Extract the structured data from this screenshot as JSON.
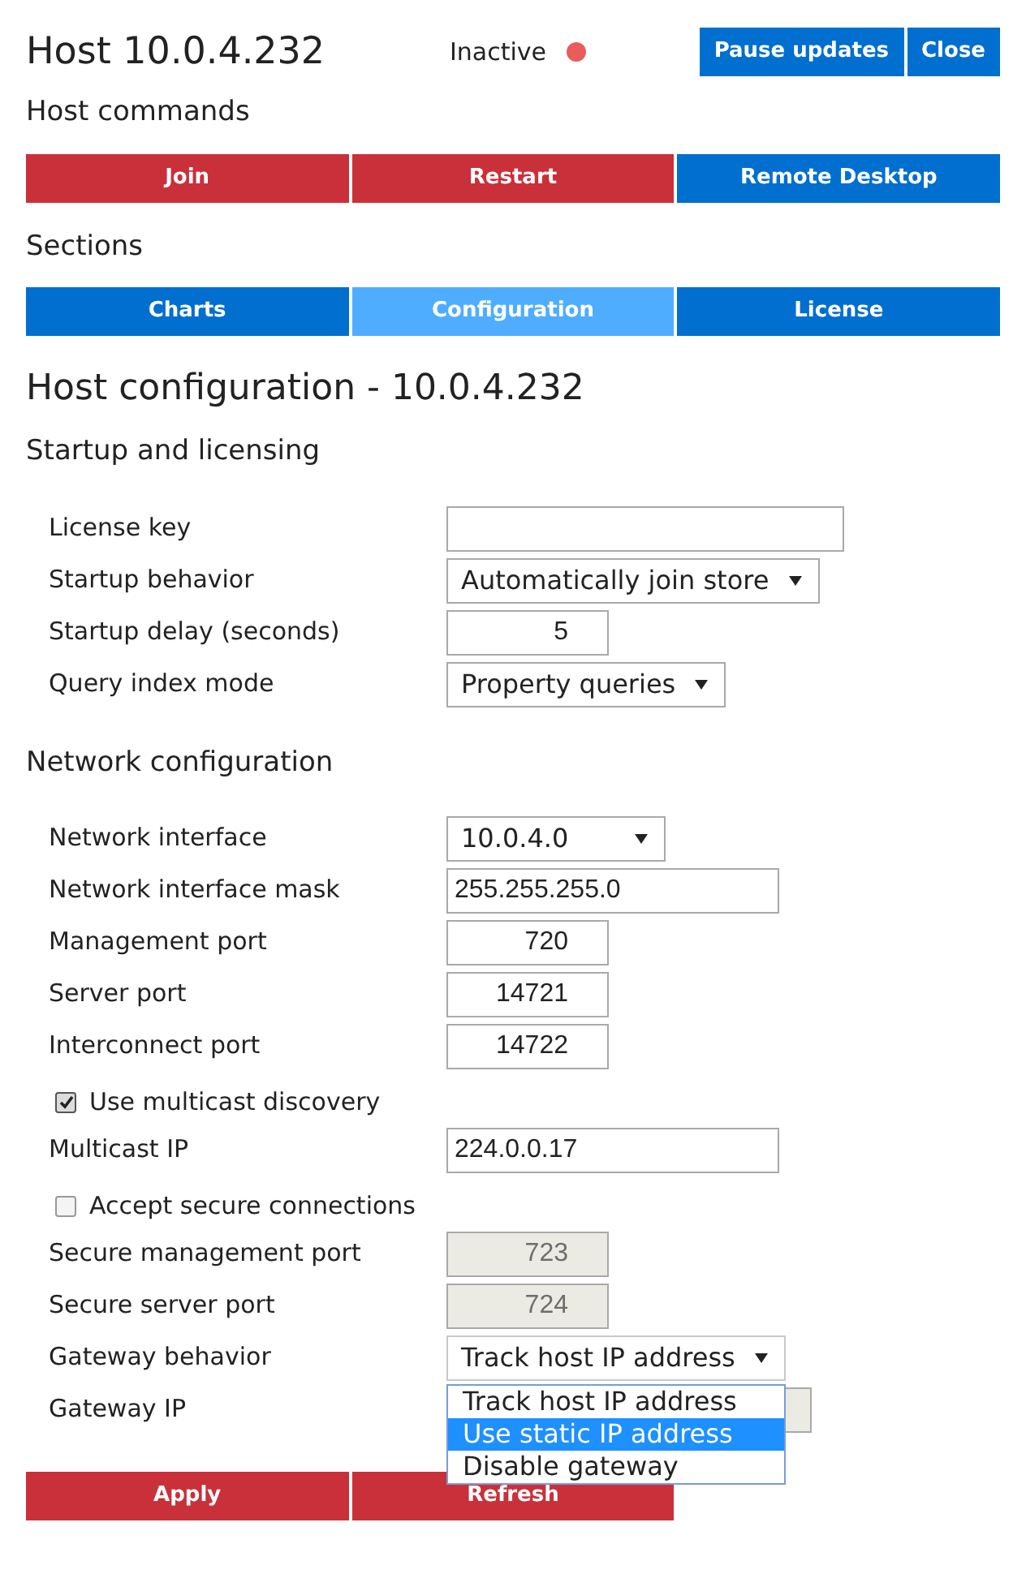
{
  "header": {
    "title": "Host 10.0.4.232",
    "status": {
      "label": "Inactive",
      "color": "#e85c5c"
    },
    "buttons": [
      "Pause updates",
      "Close"
    ]
  },
  "host_commands": {
    "title": "Host commands",
    "buttons": [
      {
        "label": "Join",
        "kind": "danger"
      },
      {
        "label": "Restart",
        "kind": "danger"
      },
      {
        "label": "Remote Desktop",
        "kind": "primary"
      }
    ]
  },
  "sections": {
    "title": "Sections",
    "tabs": [
      {
        "label": "Charts",
        "selected": false
      },
      {
        "label": "Configuration",
        "selected": true
      },
      {
        "label": "License",
        "selected": false
      }
    ]
  },
  "page_title": "Host configuration - 10.0.4.232",
  "groups": [
    {
      "title": "Startup and licensing",
      "fields": [
        {
          "kind": "text",
          "label": "License key",
          "wide": true
        },
        {
          "kind": "select",
          "label": "Startup behavior",
          "value": "Automatically join store"
        },
        {
          "kind": "number",
          "label": "Startup delay (seconds)",
          "value": "5",
          "disabled": false
        },
        {
          "kind": "select",
          "label": "Query index mode",
          "value": "Property queries"
        }
      ]
    },
    {
      "title": "Network configuration",
      "fields": [
        {
          "kind": "select",
          "label": "Network interface",
          "value": "10.0.4.0"
        },
        {
          "kind": "text",
          "label": "Network interface mask",
          "value": "255.255.255.0"
        },
        {
          "kind": "number",
          "label": "Management port",
          "value": "720",
          "disabled": false
        },
        {
          "kind": "number",
          "label": "Server port",
          "value": "14721",
          "disabled": false
        },
        {
          "kind": "number",
          "label": "Interconnect port",
          "value": "14722",
          "disabled": false
        },
        {
          "kind": "checkbox",
          "label": "Use multicast discovery",
          "checked": true
        },
        {
          "kind": "text",
          "label": "Multicast IP",
          "value": "224.0.0.17"
        },
        {
          "kind": "checkbox",
          "label": "Accept secure connections",
          "checked": false
        },
        {
          "kind": "number",
          "label": "Secure management port",
          "value": "723",
          "disabled": true
        },
        {
          "kind": "number",
          "label": "Secure server port",
          "value": "724",
          "disabled": true
        },
        {
          "kind": "select",
          "label": "Gateway behavior",
          "value": "Track host IP address",
          "expanded": true,
          "options": [
            {
              "label": "Track host IP address",
              "highlighted": false
            },
            {
              "label": "Use static IP address",
              "highlighted": true
            },
            {
              "label": "Disable gateway",
              "highlighted": false
            }
          ]
        },
        {
          "kind": "hidden",
          "label": "Gateway IP"
        }
      ]
    }
  ],
  "actions": [
    "Apply",
    "Refresh"
  ]
}
